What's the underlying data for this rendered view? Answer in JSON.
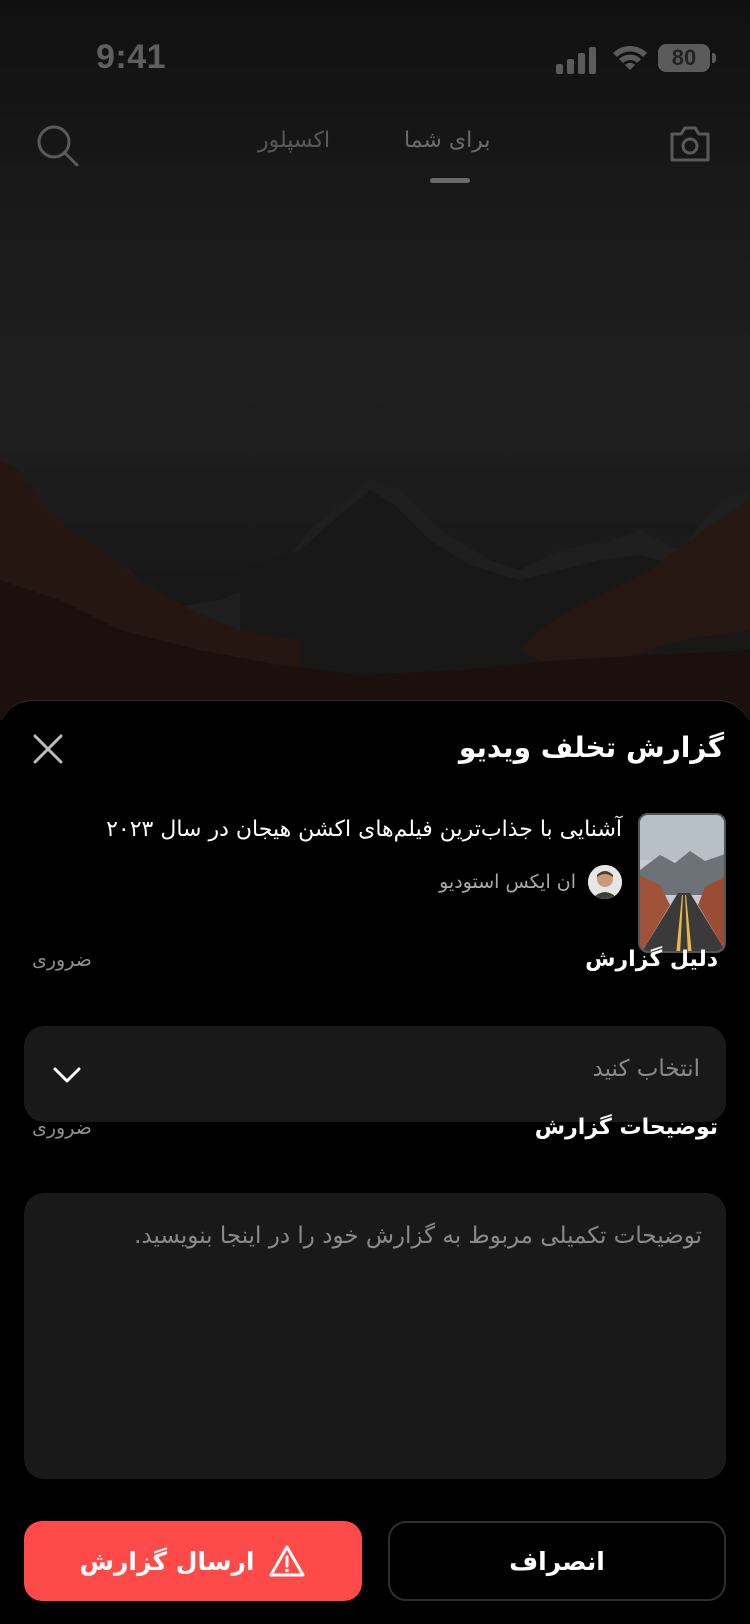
{
  "status_bar": {
    "time": "9:41",
    "battery": "80"
  },
  "top_nav": {
    "tabs": [
      {
        "label": "برای شما",
        "active": true
      },
      {
        "label": "اکسپلور",
        "active": false
      }
    ]
  },
  "report_sheet": {
    "title": "گزارش تخلف ویدیو",
    "video": {
      "title": "آشنایی با جذاب‌ترین فیلم‌های اکشن هیجان در سال ۲۰۲۳",
      "channel": "ان ایکس استودیو"
    },
    "reason": {
      "label": "دلیل گزارش",
      "required": "ضروری",
      "placeholder": "انتخاب کنید"
    },
    "description": {
      "label": "توضیحات گزارش",
      "required": "ضروری",
      "placeholder": "توضیحات تکمیلی مربوط به گزارش خود را در اینجا بنویسید."
    },
    "actions": {
      "submit_label": "ارسال گزارش",
      "cancel_label": "انصراف"
    }
  },
  "colors": {
    "accent": "#ff4a4a",
    "sheet_bg": "#000000",
    "field_bg": "#191919"
  }
}
